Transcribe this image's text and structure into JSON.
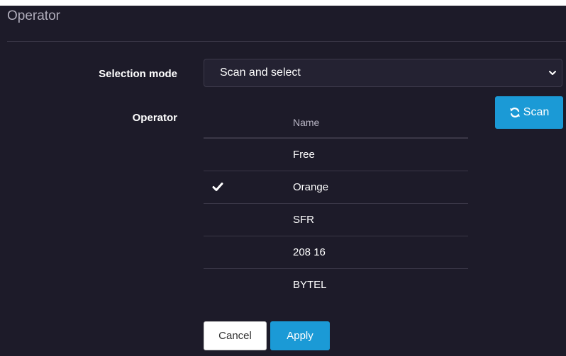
{
  "panel": {
    "title": "Operator"
  },
  "form": {
    "selection_mode": {
      "label": "Selection mode",
      "value": "Scan and select"
    },
    "operator": {
      "label": "Operator",
      "column_header": "Name",
      "selected_index": 1,
      "rows": [
        {
          "name": "Free",
          "selected": false
        },
        {
          "name": "Orange",
          "selected": true
        },
        {
          "name": "SFR",
          "selected": false
        },
        {
          "name": "208 16",
          "selected": false
        },
        {
          "name": "BYTEL",
          "selected": false
        }
      ]
    },
    "scan_button": {
      "label": "Scan",
      "icon": "refresh-icon"
    }
  },
  "actions": {
    "cancel_label": "Cancel",
    "apply_label": "Apply"
  },
  "colors": {
    "background": "#1d1b29",
    "accent": "#1b9ad6",
    "divider": "#3a3747"
  }
}
